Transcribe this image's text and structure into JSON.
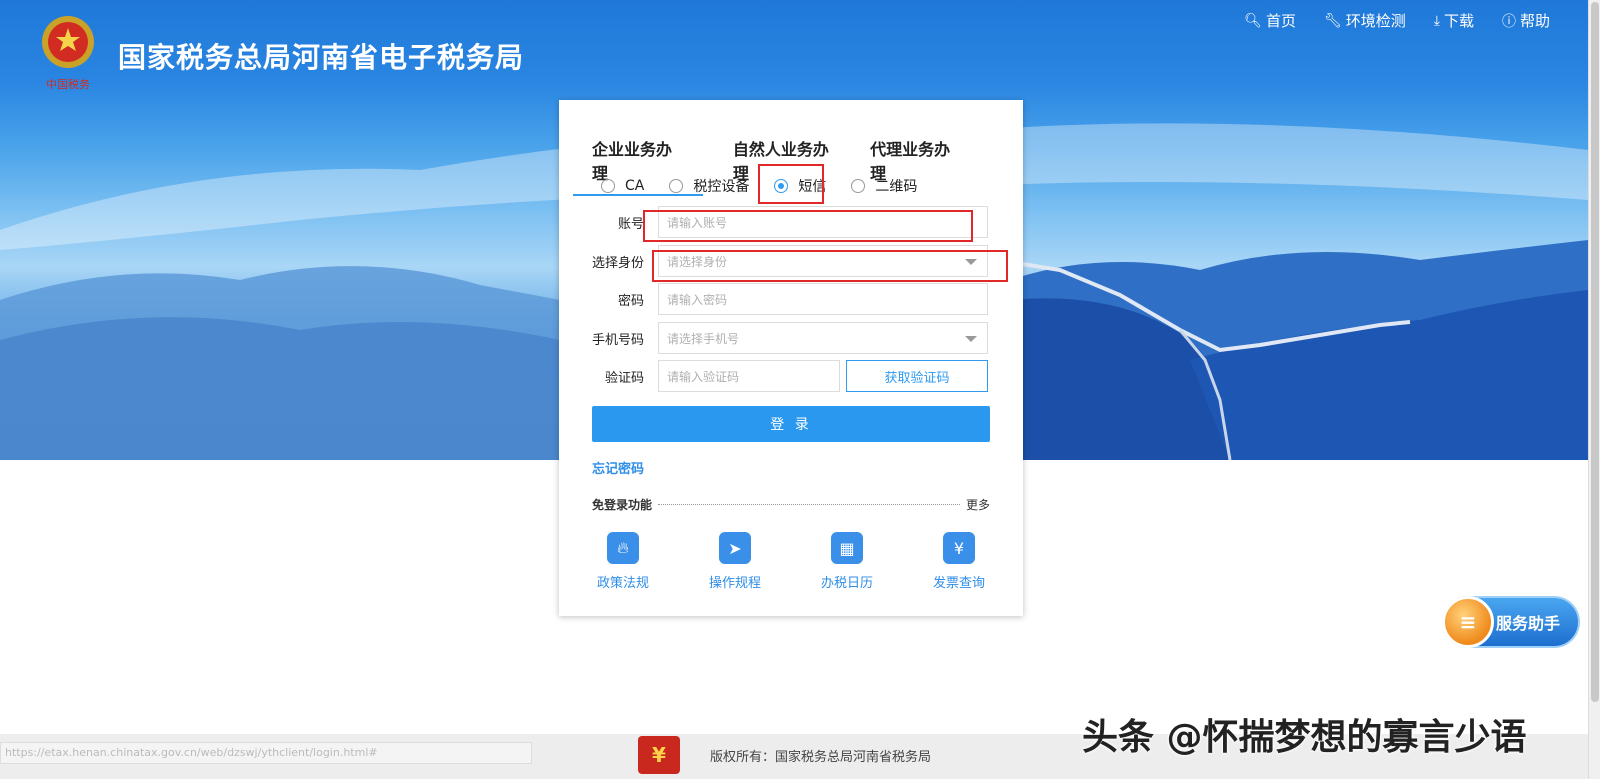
{
  "header": {
    "site_title": "国家税务总局河南省电子税务局",
    "logo_caption": "中国税务",
    "nav": [
      {
        "icon": "search-icon",
        "label": "首页"
      },
      {
        "icon": "wrench-icon",
        "label": "环境检测"
      },
      {
        "icon": "download-icon",
        "label": "下载"
      },
      {
        "icon": "help-icon",
        "label": "帮助"
      }
    ]
  },
  "login": {
    "tabs": [
      "企业业务办理",
      "自然人业务办理",
      "代理业务办理"
    ],
    "active_tab": "企业业务办理",
    "methods": [
      "CA",
      "税控设备",
      "短信",
      "二维码"
    ],
    "selected_method": "短信",
    "account_label": "账号",
    "account_placeholder": "请输入账号",
    "identity_label": "选择身份",
    "identity_placeholder": "请选择身份",
    "password_label": "密码",
    "password_placeholder": "请输入密码",
    "phone_label": "手机号码",
    "phone_placeholder": "请选择手机号",
    "code_label": "验证码",
    "code_placeholder": "请输入验证码",
    "get_code_label": "获取验证码",
    "submit_label": "登 录",
    "forgot_label": "忘记密码",
    "free_title": "免登录功能",
    "more_label": "更多",
    "shortcuts": [
      {
        "icon": "flame-icon",
        "label": "政策法规",
        "color": "#3a8fe8"
      },
      {
        "icon": "compass-icon",
        "label": "操作规程",
        "color": "#3a8fe8"
      },
      {
        "icon": "calendar-icon",
        "label": "办税日历",
        "color": "#3a8fe8"
      },
      {
        "icon": "invoice-search-icon",
        "label": "发票查询",
        "color": "#3a8fe8"
      }
    ]
  },
  "assistant": {
    "label": "服务助手"
  },
  "footer": {
    "copyright": "版权所有：国家税务总局河南省税务局",
    "status_url": "https://etax.henan.chinatax.gov.cn/web/dzswj/ythclient/login.html#"
  },
  "watermark": "头条 @怀揣梦想的寡言少语",
  "colors": {
    "primary": "#2b98f0",
    "highlight": "#e12828",
    "link": "#2f8ee8"
  }
}
